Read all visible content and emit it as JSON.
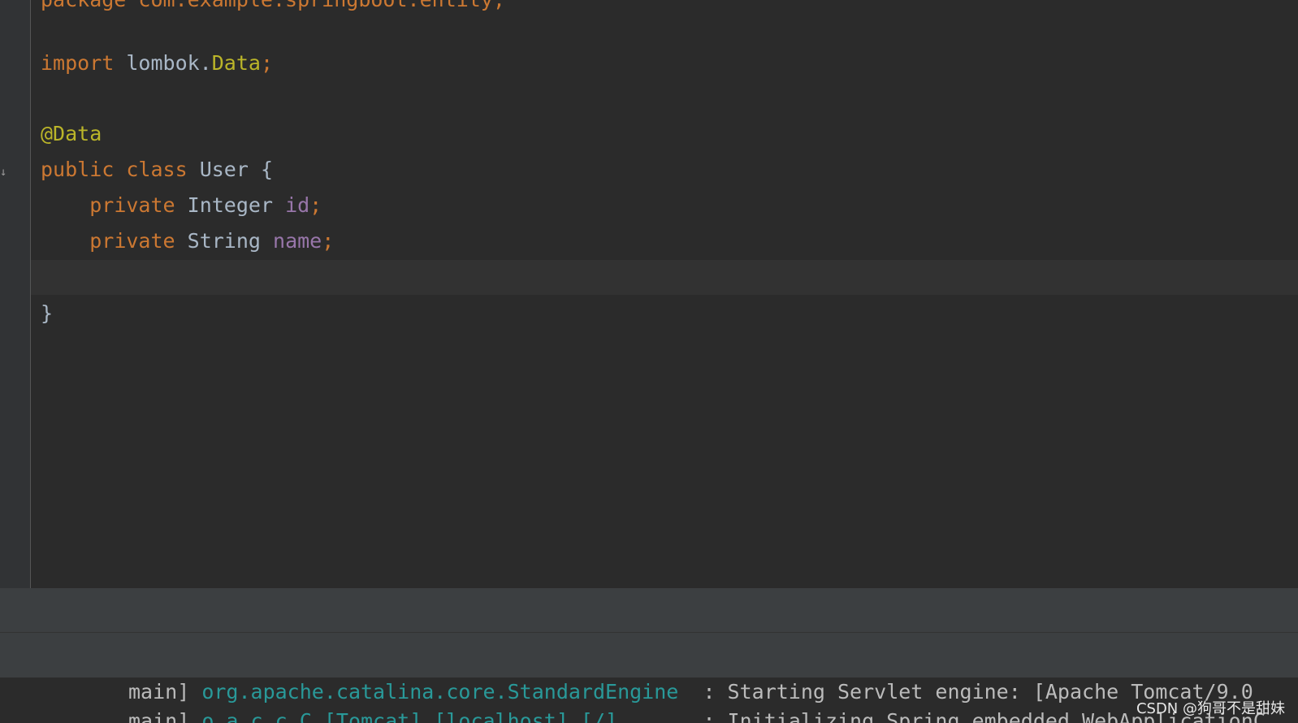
{
  "editor": {
    "line_package": {
      "kw": "package",
      "rest": " com.example.springboot.entity;"
    },
    "line_import": {
      "kw": "import",
      "pkg": "lombok.",
      "cls": "Data",
      "semi": ";"
    },
    "line_annotation": "@Data",
    "line_class": {
      "kw1": "public",
      "kw2": "class",
      "name": "User {"
    },
    "line_field1": {
      "kw": "private",
      "type": "Integer",
      "name": "id",
      "semi": ";"
    },
    "line_field2": {
      "kw": "private",
      "type": "String",
      "name": "name",
      "semi": ";"
    },
    "line_close": "}"
  },
  "console": {
    "lines": [
      {
        "thread": "main]",
        "logger": "org.apache.catalina.core.StandardEngine",
        "message": ": Starting Servlet engine: [Apache Tomcat/9.0"
      },
      {
        "thread": "main]",
        "logger": "o.a.c.c.C.[Tomcat].[localhost].[/]",
        "message": ": Initializing Spring embedded WebApplicationC"
      }
    ]
  },
  "watermark": "CSDN @狗哥不是甜妹",
  "colors": {
    "editor_bg": "#2b2b2b",
    "keyword": "#cc7832",
    "annotation": "#bbb529",
    "field": "#9876aa",
    "text": "#a9b7c6",
    "logger": "#299999"
  }
}
